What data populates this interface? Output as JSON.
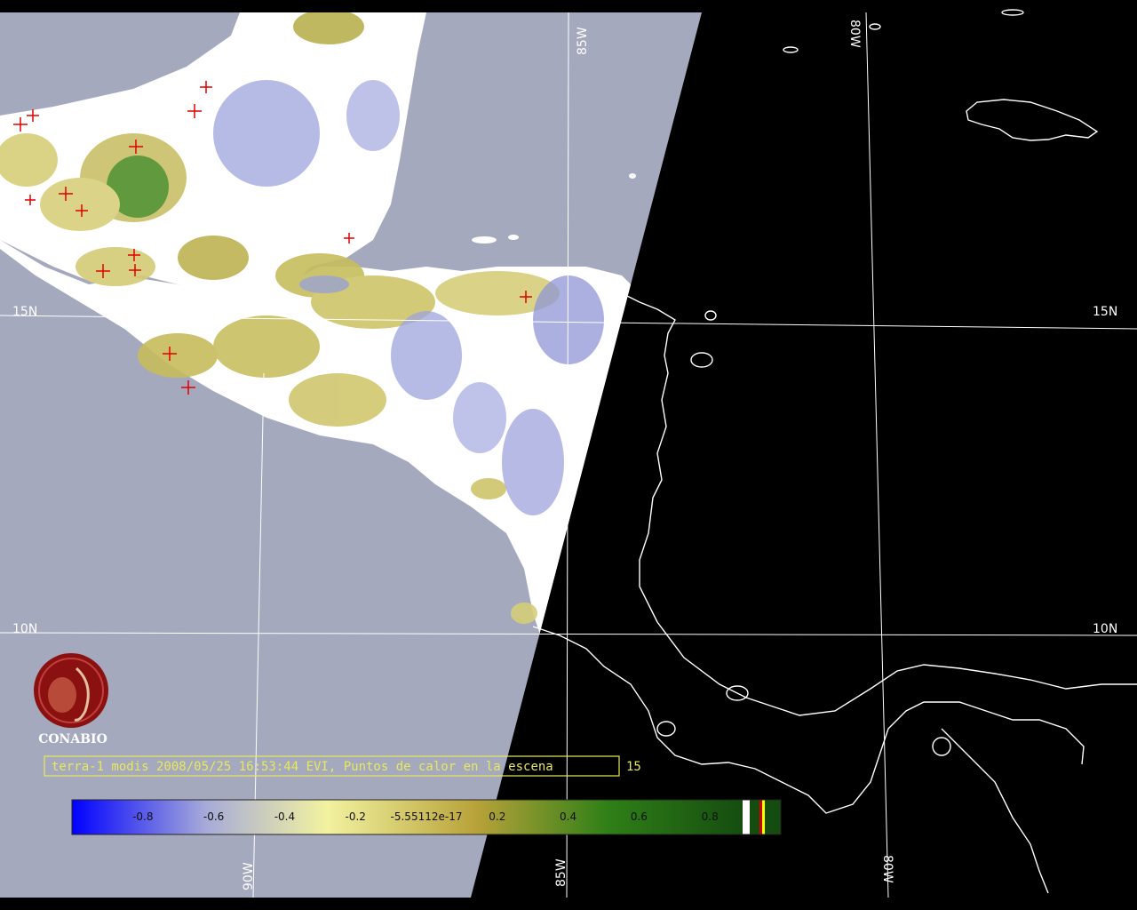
{
  "caption": {
    "text": "terra-1 modis 2008/05/25 16:53:44 EVI, Puntos de calor en la escena",
    "count": "15",
    "color": "#e8e85a"
  },
  "logo": {
    "label": "CONABIO",
    "color": "#8b1010"
  },
  "colorbar": {
    "ticks": [
      {
        "label": "-0.8",
        "value": -0.8
      },
      {
        "label": "-0.6",
        "value": -0.6
      },
      {
        "label": "-0.4",
        "value": -0.4
      },
      {
        "label": "-0.2",
        "value": -0.2
      },
      {
        "label": "-5.55112e-17",
        "value": 0.0
      },
      {
        "label": "0.2",
        "value": 0.2
      },
      {
        "label": "0.4",
        "value": 0.4
      },
      {
        "label": "0.6",
        "value": 0.6
      },
      {
        "label": "0.8",
        "value": 0.8
      }
    ],
    "stops": [
      "#0000ff",
      "#a7abd8",
      "#f2f2a0",
      "#b9a33a",
      "#2f7f17",
      "#154d10"
    ],
    "end_swatches": [
      "#ffffff",
      "#cc0000",
      "#ffff00"
    ]
  },
  "grid": {
    "lat_labels": [
      "15N",
      "10N"
    ],
    "lon_labels": [
      "90W",
      "85W",
      "80W"
    ]
  },
  "colors": {
    "ocean_day": "#a5a9be",
    "night": "#000000",
    "coastline": "#ffffff",
    "cloud": "#ffffff",
    "hotspot": "#e00000",
    "grid_line": "#ffffff"
  }
}
